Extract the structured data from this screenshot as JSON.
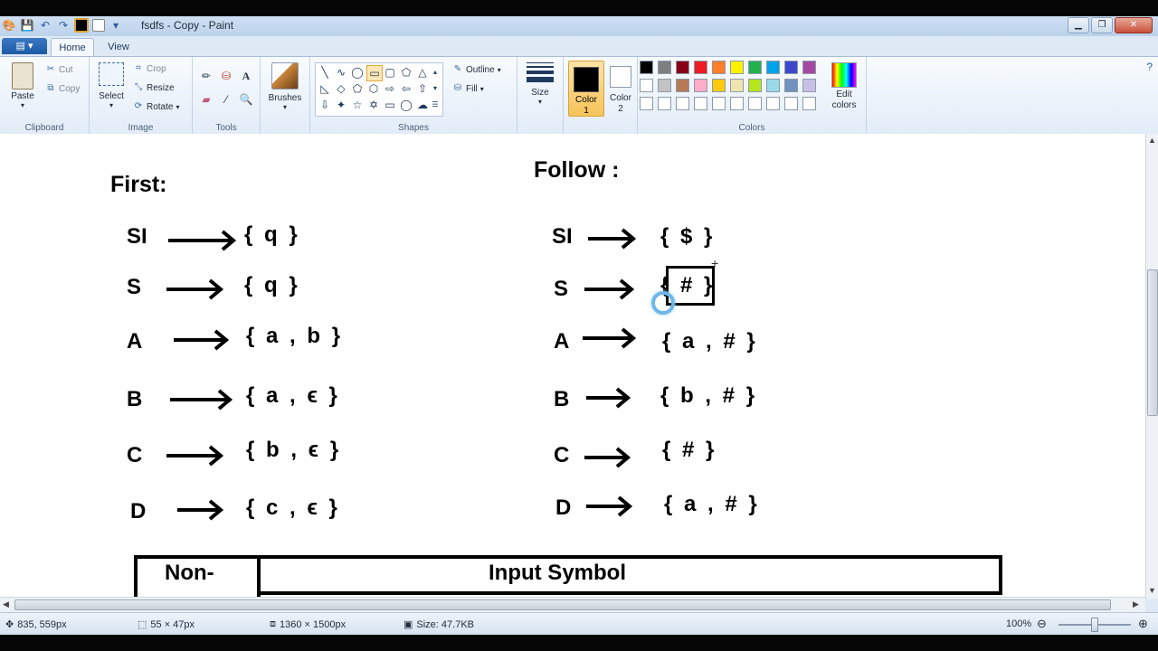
{
  "window": {
    "title": "fsdfs - Copy - Paint",
    "file_button": "▤ ▾",
    "tabs": [
      "Home",
      "View"
    ]
  },
  "ribbon": {
    "clipboard": {
      "label": "Clipboard",
      "paste": "Paste",
      "cut": "Cut",
      "copy": "Copy"
    },
    "image": {
      "label": "Image",
      "select": "Select",
      "crop": "Crop",
      "resize": "Resize",
      "rotate": "Rotate"
    },
    "tools": {
      "label": "Tools"
    },
    "brushes": {
      "label": "Brushes"
    },
    "shapes": {
      "label": "Shapes",
      "outline": "Outline",
      "fill": "Fill"
    },
    "size": {
      "label": "Size"
    },
    "color1": {
      "label1": "Color",
      "label2": "1",
      "value": "#000000"
    },
    "color2": {
      "label1": "Color",
      "label2": "2",
      "value": "#ffffff"
    },
    "colors": {
      "label": "Colors",
      "edit_label1": "Edit",
      "edit_label2": "colors",
      "row1": [
        "#000000",
        "#7f7f7f",
        "#880015",
        "#ed1c24",
        "#ff7f27",
        "#fff200",
        "#22b14c",
        "#00a2e8",
        "#3f48cc",
        "#a349a4"
      ],
      "row2": [
        "#ffffff",
        "#c3c3c3",
        "#b97a57",
        "#ffaec9",
        "#ffc90e",
        "#efe4b0",
        "#b5e61d",
        "#99d9ea",
        "#7092be",
        "#c8bfe7"
      ],
      "row3": [
        "#ffffff",
        "#ffffff",
        "#ffffff",
        "#ffffff",
        "#ffffff",
        "#ffffff",
        "#ffffff",
        "#ffffff",
        "#ffffff",
        "#ffffff"
      ]
    }
  },
  "drawing": {
    "first_title": "First:",
    "follow_title": "Follow :",
    "first_rows": [
      {
        "lhs": "SI",
        "set": "{ q }"
      },
      {
        "lhs": "S",
        "set": "{ q }"
      },
      {
        "lhs": "A",
        "set": "{ a , b }"
      },
      {
        "lhs": "B",
        "set": "{ a , ϵ }"
      },
      {
        "lhs": "C",
        "set": "{ b , ϵ }"
      },
      {
        "lhs": "D",
        "set": "{ c , ϵ }"
      }
    ],
    "follow_rows": [
      {
        "lhs": "SI",
        "set": "{ $ }"
      },
      {
        "lhs": "S",
        "set": "{ # }"
      },
      {
        "lhs": "A",
        "set": "{ a , # }"
      },
      {
        "lhs": "B",
        "set": "{ b , # }"
      },
      {
        "lhs": "C",
        "set": "{ # }"
      },
      {
        "lhs": "D",
        "set": "{ a , # }"
      }
    ],
    "table_left_header": "Non-",
    "table_right_header": "Input Symbol"
  },
  "status": {
    "cursor_pos": "835, 559px",
    "selection_size": "55 × 47px",
    "image_size": "1360 × 1500px",
    "file_size": "Size: 47.7KB",
    "zoom": "100%"
  }
}
